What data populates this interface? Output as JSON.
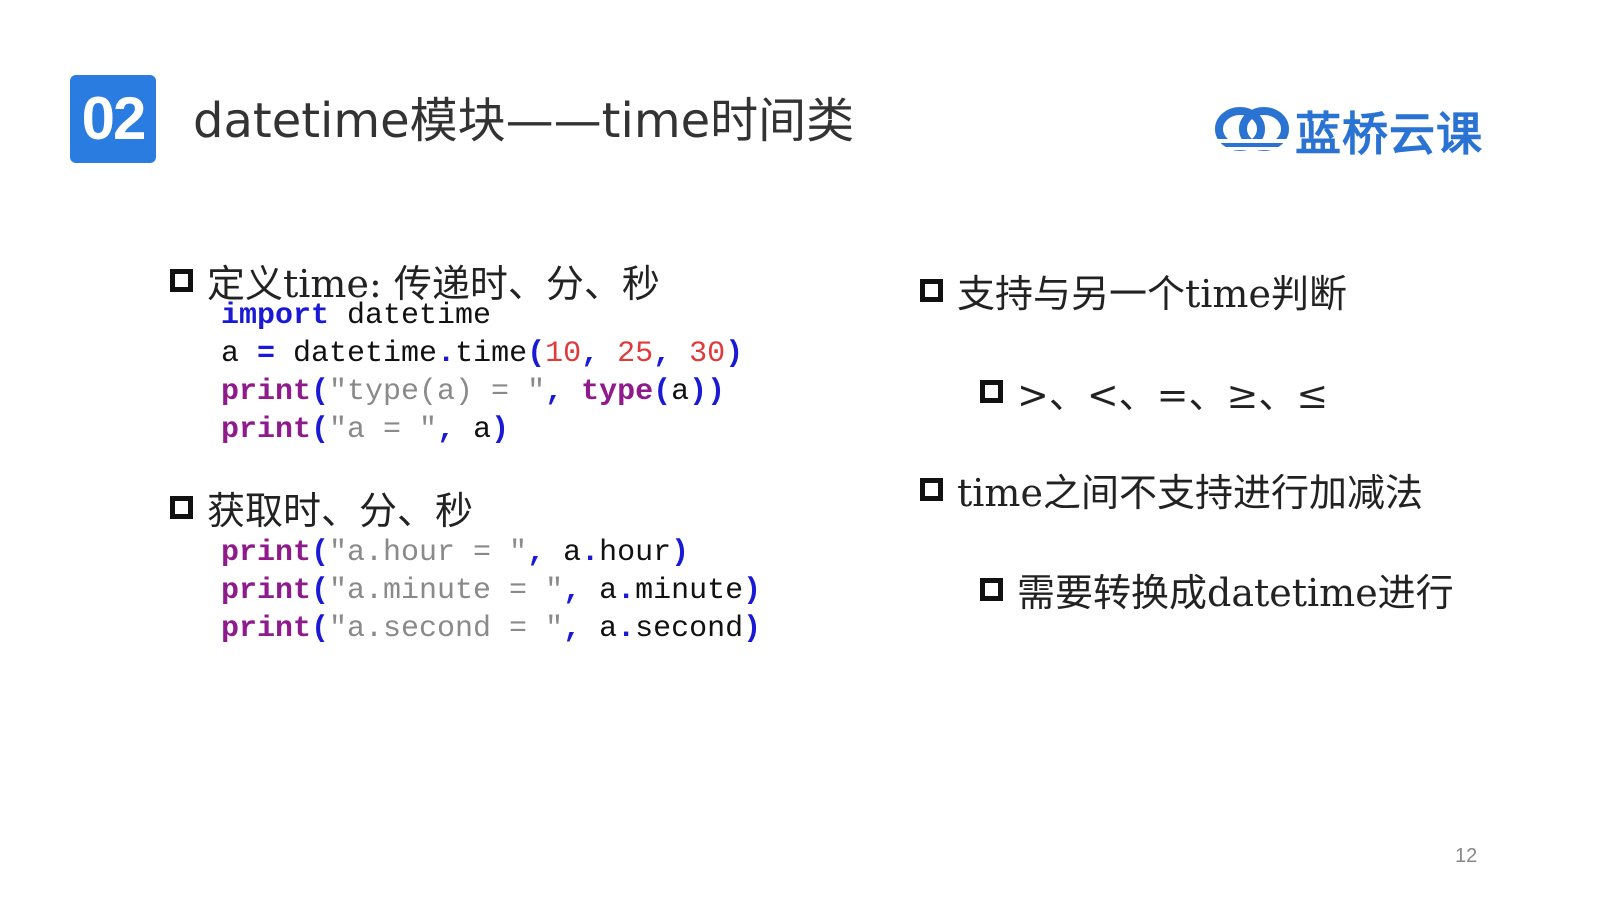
{
  "header": {
    "section_number": "02",
    "title": "datetime模块——time时间类",
    "logo_text": "蓝桥云课",
    "brand_color": "#2b73d2"
  },
  "left_column": {
    "bullet1": "定义time:  传递时、分、秒",
    "code1": [
      [
        {
          "t": "import",
          "c": "kw"
        },
        {
          "t": " datetime",
          "c": "pl"
        }
      ],
      [
        {
          "t": "a ",
          "c": "pl"
        },
        {
          "t": "=",
          "c": "op"
        },
        {
          "t": " datetime",
          "c": "pl"
        },
        {
          "t": ".",
          "c": "op"
        },
        {
          "t": "time",
          "c": "pl"
        },
        {
          "t": "(",
          "c": "pn"
        },
        {
          "t": "10",
          "c": "num"
        },
        {
          "t": ", ",
          "c": "pn"
        },
        {
          "t": "25",
          "c": "num"
        },
        {
          "t": ", ",
          "c": "pn"
        },
        {
          "t": "30",
          "c": "num"
        },
        {
          "t": ")",
          "c": "pn"
        }
      ],
      [
        {
          "t": "print",
          "c": "fn"
        },
        {
          "t": "(",
          "c": "pn"
        },
        {
          "t": "\"type(a) = \"",
          "c": "str"
        },
        {
          "t": ", ",
          "c": "pn"
        },
        {
          "t": "type",
          "c": "fn"
        },
        {
          "t": "(",
          "c": "pn"
        },
        {
          "t": "a",
          "c": "pl"
        },
        {
          "t": "))",
          "c": "pn"
        }
      ],
      [
        {
          "t": "print",
          "c": "fn"
        },
        {
          "t": "(",
          "c": "pn"
        },
        {
          "t": "\"a = \"",
          "c": "str"
        },
        {
          "t": ", ",
          "c": "pn"
        },
        {
          "t": "a",
          "c": "pl"
        },
        {
          "t": ")",
          "c": "pn"
        }
      ]
    ],
    "bullet2": "获取时、分、秒",
    "code2": [
      [
        {
          "t": "print",
          "c": "fn"
        },
        {
          "t": "(",
          "c": "pn"
        },
        {
          "t": "\"a.hour = \"",
          "c": "str"
        },
        {
          "t": ", ",
          "c": "pn"
        },
        {
          "t": "a",
          "c": "pl"
        },
        {
          "t": ".",
          "c": "op"
        },
        {
          "t": "hour",
          "c": "pl"
        },
        {
          "t": ")",
          "c": "pn"
        }
      ],
      [
        {
          "t": "print",
          "c": "fn"
        },
        {
          "t": "(",
          "c": "pn"
        },
        {
          "t": "\"a.minute = \"",
          "c": "str"
        },
        {
          "t": ", ",
          "c": "pn"
        },
        {
          "t": "a",
          "c": "pl"
        },
        {
          "t": ".",
          "c": "op"
        },
        {
          "t": "minute",
          "c": "pl"
        },
        {
          "t": ")",
          "c": "pn"
        }
      ],
      [
        {
          "t": "print",
          "c": "fn"
        },
        {
          "t": "(",
          "c": "pn"
        },
        {
          "t": "\"a.second = \"",
          "c": "str"
        },
        {
          "t": ", ",
          "c": "pn"
        },
        {
          "t": "a",
          "c": "pl"
        },
        {
          "t": ".",
          "c": "op"
        },
        {
          "t": "second",
          "c": "pl"
        },
        {
          "t": ")",
          "c": "pn"
        }
      ]
    ]
  },
  "right_column": {
    "bullet1": "支持与另一个time判断",
    "sub_bullet1": ">、<、=、≥、≤",
    "bullet2": "time之间不支持进行加减法",
    "sub_bullet2": "需要转换成datetime进行"
  },
  "footer": {
    "page_number": "12"
  }
}
